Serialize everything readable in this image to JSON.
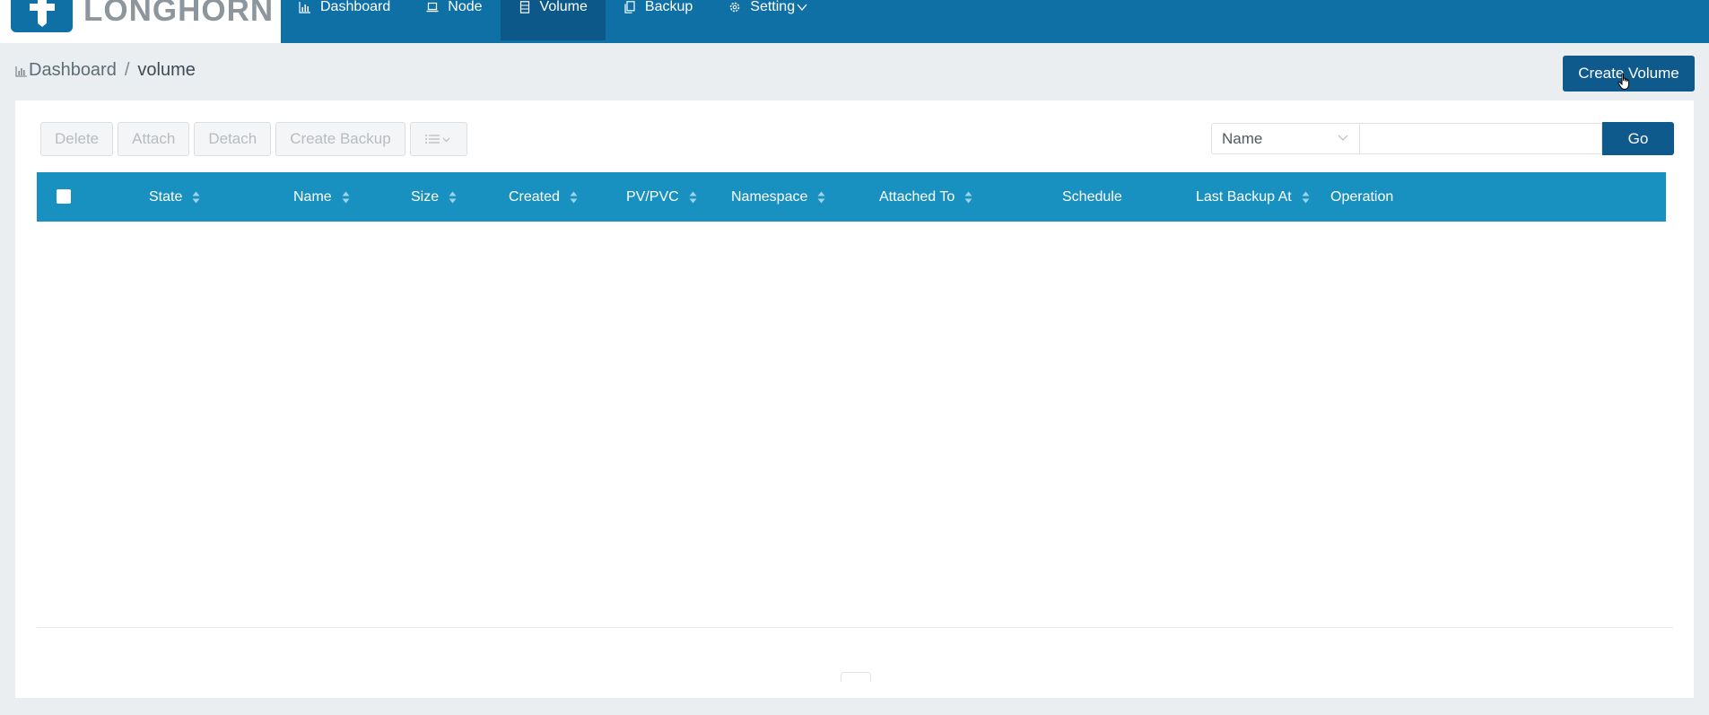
{
  "app": {
    "logo_text": "LONGHORN"
  },
  "nav": {
    "items": [
      {
        "label": "Dashboard",
        "icon": "bar-chart-icon"
      },
      {
        "label": "Node",
        "icon": "laptop-icon"
      },
      {
        "label": "Volume",
        "icon": "database-icon",
        "active": true
      },
      {
        "label": "Backup",
        "icon": "copy-icon"
      },
      {
        "label": "Setting",
        "icon": "gear-icon"
      }
    ]
  },
  "breadcrumb": {
    "root": "Dashboard",
    "separator": "/",
    "current": "volume"
  },
  "actions": {
    "create_volume": "Create Volume"
  },
  "toolbar": {
    "delete": "Delete",
    "attach": "Attach",
    "detach": "Detach",
    "create_backup": "Create Backup",
    "more_icon": "list-icon"
  },
  "search": {
    "field_selected": "Name",
    "value": "",
    "go_label": "Go"
  },
  "table": {
    "columns": [
      {
        "label": "State",
        "sortable": true
      },
      {
        "label": "Name",
        "sortable": true
      },
      {
        "label": "Size",
        "sortable": true
      },
      {
        "label": "Created",
        "sortable": true
      },
      {
        "label": "PV/PVC",
        "sortable": true
      },
      {
        "label": "Namespace",
        "sortable": true
      },
      {
        "label": "Attached To",
        "sortable": true
      },
      {
        "label": "Schedule",
        "sortable": false
      },
      {
        "label": "Last Backup At",
        "sortable": true
      },
      {
        "label": "Operation",
        "sortable": false
      }
    ],
    "rows": []
  },
  "colors": {
    "header": "#0f70a6",
    "nav_active": "#0b5889",
    "table_header": "#1890c0",
    "primary_button": "#0f5a8c",
    "page_bg": "#eaeef0"
  }
}
